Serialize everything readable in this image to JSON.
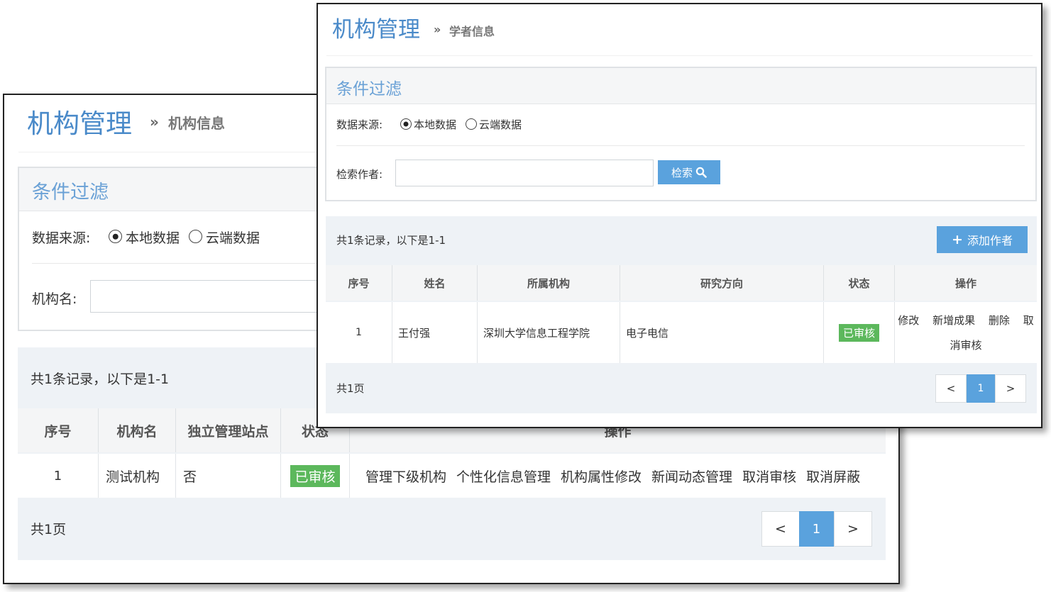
{
  "back": {
    "title": "机构管理",
    "breadcrumb_sep": "»",
    "breadcrumb": "机构信息",
    "filter_title": "条件过滤",
    "source_label": "数据来源:",
    "radio_local": "本地数据",
    "radio_cloud": "云端数据",
    "name_label": "机构名:",
    "record_summary": "共1条记录，以下是1-1",
    "headers": [
      "序号",
      "机构名",
      "独立管理站点",
      "状态",
      "操作"
    ],
    "row": {
      "index": "1",
      "name": "测试机构",
      "standalone": "否",
      "status": "已审核",
      "ops": [
        "管理下级机构",
        "个性化信息管理",
        "机构属性修改",
        "新闻动态管理",
        "取消审核",
        "取消屏蔽"
      ]
    },
    "pages_total": "共1页",
    "pager": {
      "prev": "<",
      "current": "1",
      "next": ">"
    }
  },
  "front": {
    "title": "机构管理",
    "breadcrumb_sep": "»",
    "breadcrumb": "学者信息",
    "filter_title": "条件过滤",
    "source_label": "数据来源:",
    "radio_local": "本地数据",
    "radio_cloud": "云端数据",
    "author_label": "检索作者:",
    "search_button": "检索",
    "record_summary": "共1条记录，以下是1-1",
    "add_button": "添加作者",
    "headers": [
      "序号",
      "姓名",
      "所属机构",
      "研究方向",
      "状态",
      "操作"
    ],
    "row": {
      "index": "1",
      "name": "王付强",
      "org": "深圳大学信息工程学院",
      "field": "电子电信",
      "status": "已审核",
      "ops_line1": [
        "修改",
        "新增成果",
        "删除",
        "取"
      ],
      "ops_line2": "消审核"
    },
    "pages_total": "共1页",
    "pager": {
      "prev": "<",
      "current": "1",
      "next": ">"
    }
  },
  "colors": {
    "accent": "#5aa2dd",
    "title": "#4a8ac9",
    "success": "#5cb85c"
  }
}
